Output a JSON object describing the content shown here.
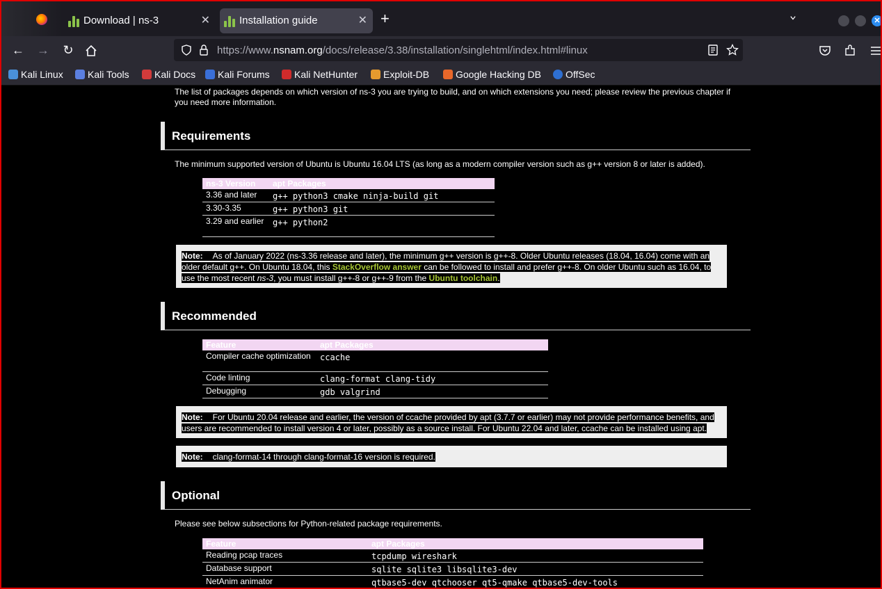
{
  "browser": {
    "tabs": [
      {
        "title": "Download | ns-3"
      },
      {
        "title": "Installation guide"
      }
    ],
    "url": {
      "prefix": "https://www.",
      "host": "nsnam.org",
      "path": "/docs/release/3.38/installation/singlehtml/index.html#linux"
    },
    "bookmarks": [
      {
        "label": "Kali Linux",
        "color": "#4a90d9"
      },
      {
        "label": "Kali Tools",
        "color": "#5b7fe0"
      },
      {
        "label": "Kali Docs",
        "color": "#d23b3b"
      },
      {
        "label": "Kali Forums",
        "color": "#3a6fd8"
      },
      {
        "label": "Kali NetHunter",
        "color": "#d02b2b"
      },
      {
        "label": "Exploit-DB",
        "color": "#e69a2e"
      },
      {
        "label": "Google Hacking DB",
        "color": "#e8672a"
      },
      {
        "label": "OffSec",
        "color": "#2e6fd1"
      }
    ]
  },
  "page": {
    "intro": "The list of packages depends on which version of ns-3 you are trying to build, and on which extensions you need; please review the previous chapter if you need more information.",
    "requirements": {
      "heading": "Requirements",
      "text": "The minimum supported version of Ubuntu is Ubuntu 16.04 LTS (as long as a modern compiler version such as g++ version 8 or later is added).",
      "table": {
        "headers": [
          "ns-3 Version",
          "apt Packages"
        ],
        "rows": [
          [
            "3.36 and later",
            "g++ python3 cmake ninja-build git"
          ],
          [
            "3.30-3.35",
            "g++ python3 git"
          ],
          [
            "3.29 and earlier",
            "g++ python2"
          ]
        ]
      },
      "note": {
        "label": "Note:",
        "t1": "As of January 2022 (ns-3.36 release and later), the minimum g++ version is g++-8. Older Ubuntu releases (18.04, 16.04) come with an older default g++. On Ubuntu 18.04, this ",
        "link1": "StackOverflow answer",
        "t2": " can be followed to install and prefer g++-8. On older Ubuntu such as 16.04, to use the most recent ",
        "em": "ns-3",
        "t3": ", you must install g++-8 or g++-9 from the ",
        "link2": "Ubuntu toolchain",
        "t4": "."
      }
    },
    "recommended": {
      "heading": "Recommended",
      "table": {
        "headers": [
          "Feature",
          "apt Packages"
        ],
        "rows": [
          [
            "Compiler cache optimization",
            "ccache"
          ],
          [
            "Code linting",
            "clang-format clang-tidy"
          ],
          [
            "Debugging",
            "gdb valgrind"
          ]
        ]
      },
      "note1": {
        "label": "Note:",
        "text": "For Ubuntu 20.04 release and earlier, the version of ccache provided by apt (3.7.7 or earlier) may not provide performance benefits, and users are recommended to install version 4 or later, possibly as a source install. For Ubuntu 22.04 and later, ccache can be installed using apt."
      },
      "note2": {
        "label": "Note:",
        "text": "clang-format-14 through clang-format-16 version is required."
      }
    },
    "optional": {
      "heading": "Optional",
      "text": "Please see below subsections for Python-related package requirements.",
      "table": {
        "headers": [
          "Feature",
          "apt Packages"
        ],
        "rows": [
          [
            "Reading pcap traces",
            "tcpdump wireshark"
          ],
          [
            "Database support",
            "sqlite sqlite3 libsqlite3-dev"
          ],
          [
            "NetAnim animator",
            "qtbase5-dev qtchooser qt5-qmake qtbase5-dev-tools"
          ]
        ]
      }
    }
  }
}
